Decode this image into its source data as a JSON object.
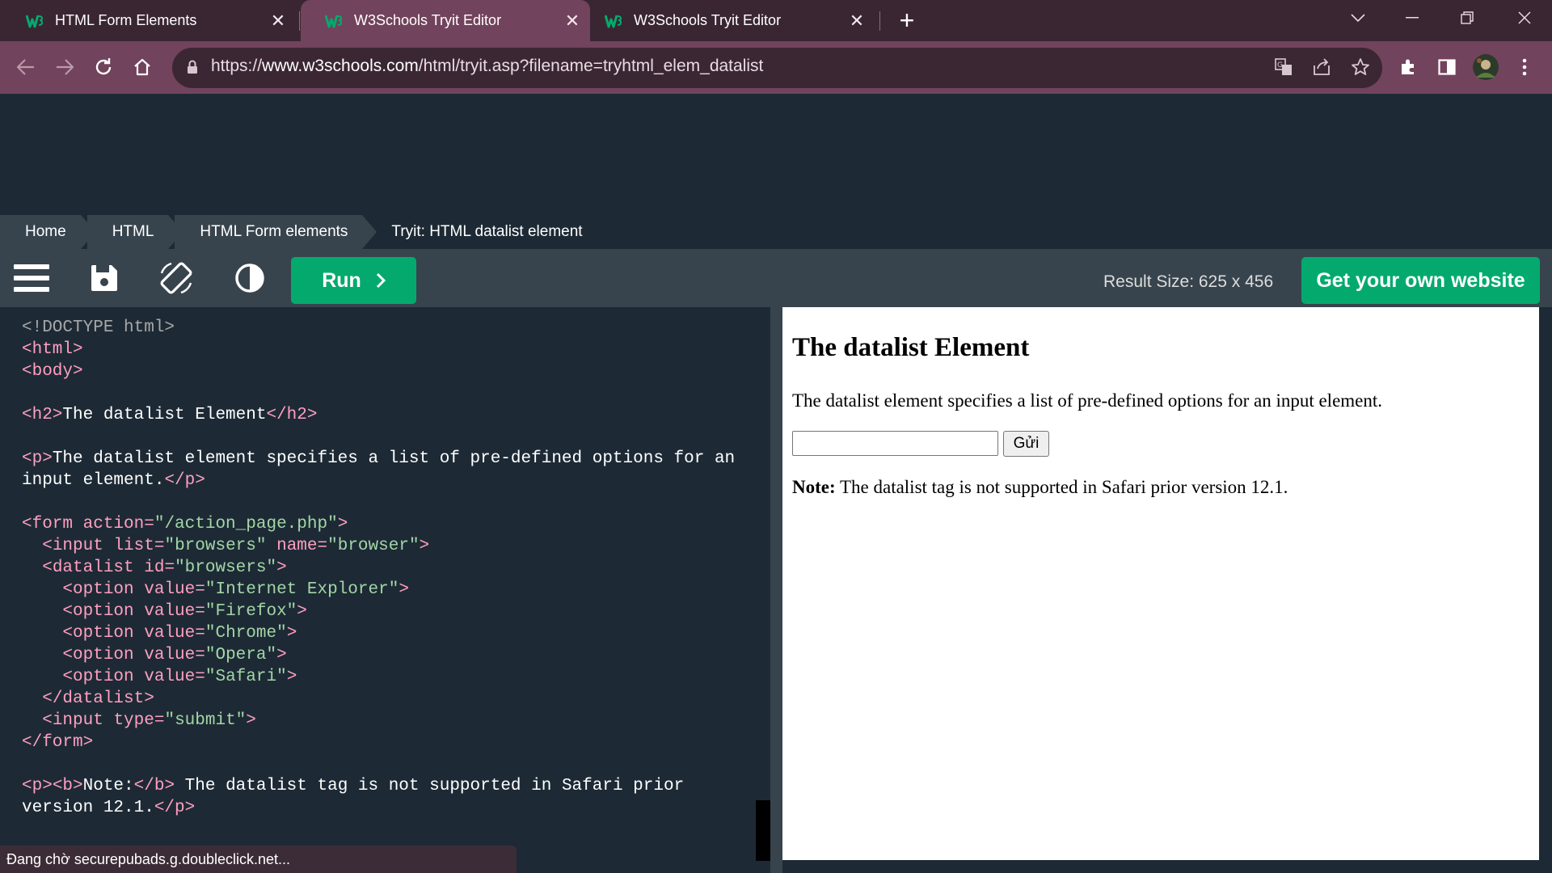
{
  "tabs": [
    {
      "title": "HTML Form Elements",
      "active": false
    },
    {
      "title": "W3Schools Tryit Editor",
      "active": true
    },
    {
      "title": "W3Schools Tryit Editor",
      "active": false
    }
  ],
  "address": {
    "scheme": "https://",
    "host": "www.w3schools.com",
    "path": "/html/tryit.asp?filename=tryhtml_elem_datalist"
  },
  "breadcrumb": [
    "Home",
    "HTML",
    "HTML Form elements",
    "Tryit: HTML datalist element"
  ],
  "editor": {
    "run_label": "Run",
    "result_size": "Result Size: 625 x 456",
    "own_site_label": "Get your own website"
  },
  "result": {
    "heading": "The datalist Element",
    "paragraph": "The datalist element specifies a list of pre-defined options for an input element.",
    "input_value": "",
    "submit_label": "Gửi",
    "note_bold": "Note:",
    "note_text": " The datalist tag is not supported in Safari prior version 12.1."
  },
  "status": "Đang chờ securepubads.g.doubleclick.net...",
  "colors": {
    "tab_bar": "#3a2633",
    "toolbar": "#72435c",
    "page_bg": "#1d2a35",
    "panel": "#38444d",
    "accent_green": "#04aa6d"
  },
  "code": {
    "doctype": "<!DOCTYPE html>",
    "t_html": "<html>",
    "t_body": "<body>",
    "t_h2_open": "<h2>",
    "h2_text": "The datalist Element",
    "t_h2_close": "</h2>",
    "t_p_open": "<p>",
    "p_text_1": "The datalist element specifies a list of pre-defined options for an",
    "p_text_2": "input element.",
    "t_p_close": "</p>",
    "t_form": "<form",
    "a_action": " action=",
    "v_action": "\"/action_page.php\"",
    "gt": ">",
    "t_input": "<input",
    "a_list": " list=",
    "v_list": "\"browsers\"",
    "a_name": " name=",
    "v_name": "\"browser\"",
    "t_datalist": "<datalist",
    "a_id": " id=",
    "v_id": "\"browsers\"",
    "t_option": "<option",
    "a_value": " value=",
    "options": [
      "\"Internet Explorer\"",
      "\"Firefox\"",
      "\"Chrome\"",
      "\"Opera\"",
      "\"Safari\""
    ],
    "t_datalist_close": "</datalist>",
    "a_type": " type=",
    "v_type": "\"submit\"",
    "t_form_close": "</form>",
    "t_b_open": "<b>",
    "note_b": "Note:",
    "t_b_close": "</b>",
    "note_1": " The datalist tag is not supported in Safari prior",
    "note_2": "version 12.1."
  },
  "icons": {
    "favicon": "w3schools-icon",
    "menu": "hamburger-icon",
    "save": "floppy-disk-icon",
    "rotate": "rotate-icon",
    "theme": "contrast-icon"
  }
}
